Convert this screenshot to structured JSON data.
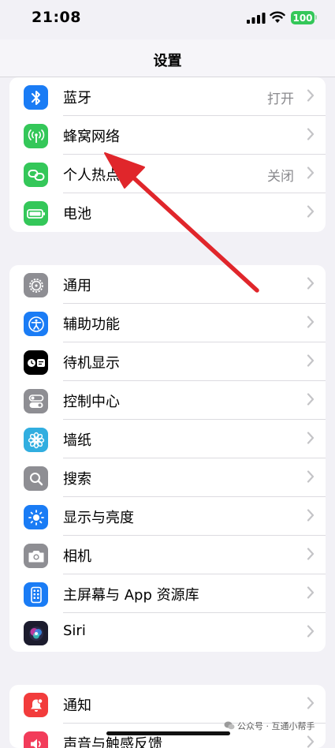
{
  "status_bar": {
    "time": "21:08",
    "battery": "100"
  },
  "nav": {
    "title": "设置"
  },
  "groups": [
    {
      "rows": [
        {
          "label": "蓝牙",
          "value": "打开",
          "icon": "bluetooth-icon",
          "color": "#1a7cf5"
        },
        {
          "label": "蜂窝网络",
          "value": "",
          "icon": "cellular-antenna-icon",
          "color": "#34c759"
        },
        {
          "label": "个人热点",
          "value": "关闭",
          "icon": "hotspot-link-icon",
          "color": "#34c759"
        },
        {
          "label": "电池",
          "value": "",
          "icon": "battery-icon",
          "color": "#34c759"
        }
      ]
    },
    {
      "rows": [
        {
          "label": "通用",
          "icon": "gear-icon",
          "color": "#8e8e93"
        },
        {
          "label": "辅助功能",
          "icon": "accessibility-icon",
          "color": "#1a7cf5"
        },
        {
          "label": "待机显示",
          "icon": "standby-icon",
          "color": "#000000"
        },
        {
          "label": "控制中心",
          "icon": "toggles-icon",
          "color": "#8e8e93"
        },
        {
          "label": "墙纸",
          "icon": "flower-icon",
          "color": "#31aee0"
        },
        {
          "label": "搜索",
          "icon": "search-icon",
          "color": "#8e8e93"
        },
        {
          "label": "显示与亮度",
          "icon": "sun-icon",
          "color": "#1a7cf5"
        },
        {
          "label": "相机",
          "icon": "camera-icon",
          "color": "#8e8e93"
        },
        {
          "label": "主屏幕与 App 资源库",
          "icon": "home-screen-icon",
          "color": "#1a7cf5"
        },
        {
          "label": "Siri",
          "icon": "siri-icon",
          "color": "#1c1c2e"
        }
      ]
    },
    {
      "rows": [
        {
          "label": "通知",
          "icon": "bell-icon",
          "color": "#f23c3c"
        },
        {
          "label": "声音与触感反馈",
          "icon": "speaker-icon",
          "color": "#f23c5a"
        }
      ]
    }
  ],
  "watermark": "公众号 · 互通小帮手"
}
